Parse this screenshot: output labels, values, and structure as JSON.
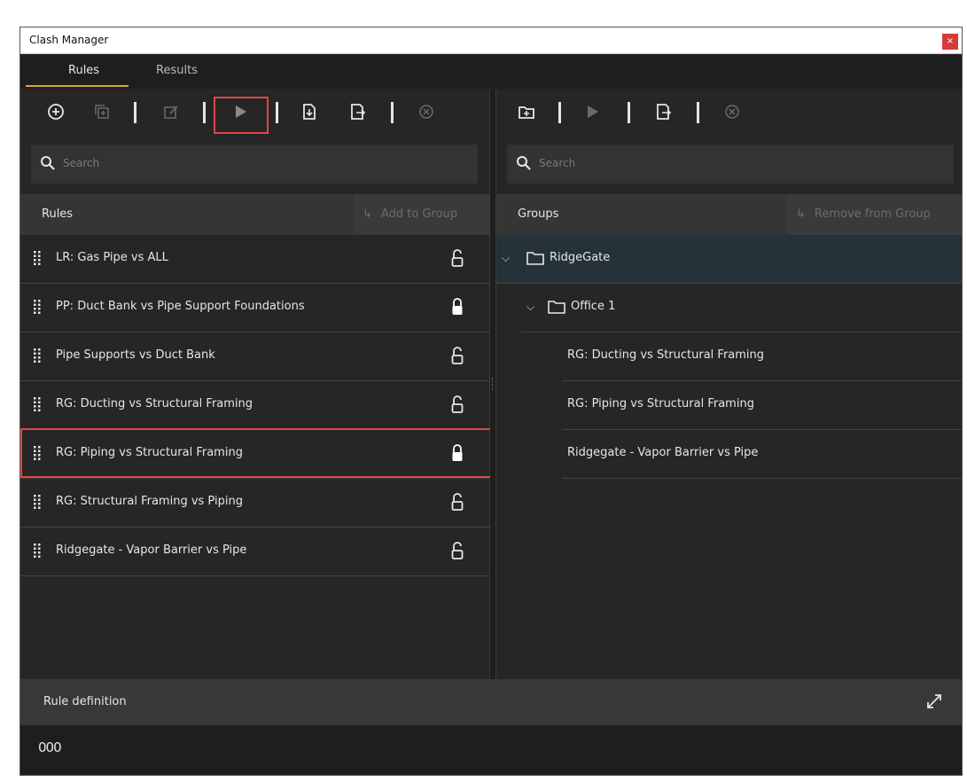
{
  "window": {
    "title": "Clash Manager",
    "close_label": "×"
  },
  "tabs": [
    {
      "label": "Rules",
      "active": true
    },
    {
      "label": "Results",
      "active": false
    }
  ],
  "left": {
    "toolbar": [
      "add-icon",
      "copy-icon",
      "edit-icon",
      "run-icon",
      "import-icon",
      "export-icon",
      "delete-icon"
    ],
    "search_placeholder": "Search",
    "header_label": "Rules",
    "action_label": "Add to Group",
    "rules": [
      {
        "name": "LR: Gas Pipe vs ALL",
        "locked": false
      },
      {
        "name": "PP: Duct Bank vs Pipe Support Foundations",
        "locked": true
      },
      {
        "name": "Pipe Supports vs Duct Bank",
        "locked": false
      },
      {
        "name": "RG: Ducting vs Structural Framing",
        "locked": false
      },
      {
        "name": "RG: Piping vs Structural Framing",
        "locked": true
      },
      {
        "name": "RG: Structural Framing vs Piping",
        "locked": false
      },
      {
        "name": "Ridgegate - Vapor Barrier vs Pipe",
        "locked": false
      }
    ]
  },
  "right": {
    "search_placeholder": "Search",
    "header_label": "Groups",
    "action_label": "Remove from Group",
    "tree": {
      "root": "RidgeGate",
      "child": "Office 1",
      "items": [
        "RG: Ducting vs Structural Framing",
        "RG: Piping vs Structural Framing",
        "Ridgegate - Vapor Barrier vs Pipe"
      ]
    }
  },
  "bottom": {
    "definition_label": "Rule definition",
    "columns_glyph": "000"
  },
  "colors": {
    "accent": "#d9a441",
    "highlight": "#e04646",
    "selected_row": "#253238"
  }
}
